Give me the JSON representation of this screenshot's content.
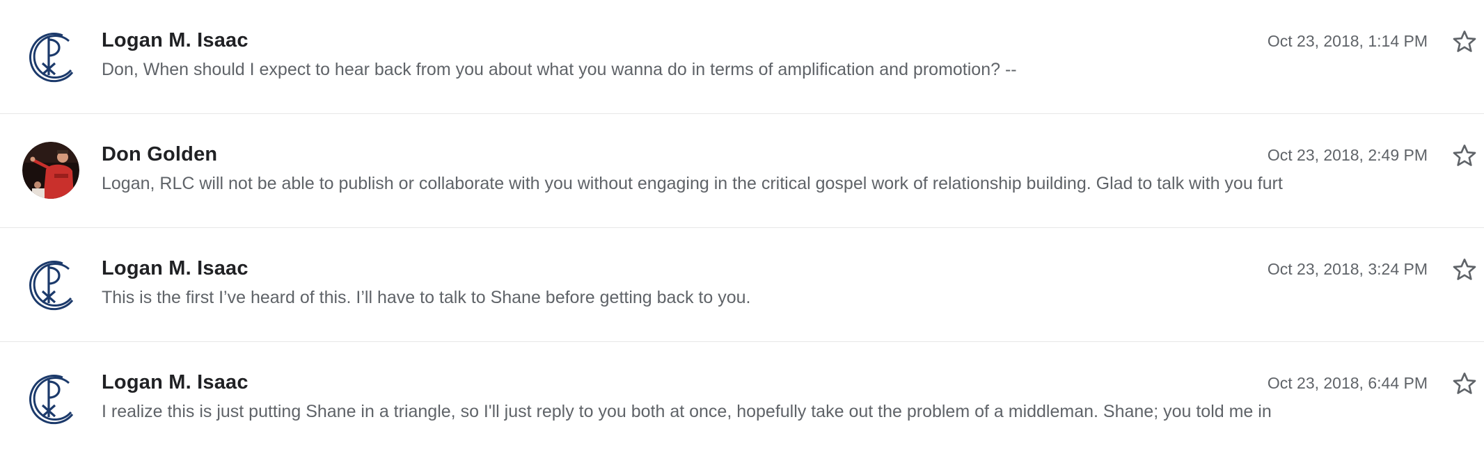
{
  "messages": [
    {
      "sender": "Logan M. Isaac",
      "avatar": "chi-rho-logo-icon",
      "date": "Oct 23, 2018, 1:14 PM",
      "snippet": "Don, When should I expect to hear back from you about what you wanna do in terms of amplification and promotion? --",
      "starred": false
    },
    {
      "sender": "Don Golden",
      "avatar": "profile-photo",
      "date": "Oct 23, 2018, 2:49 PM",
      "snippet": "Logan, RLC will not be able to publish or collaborate with you without engaging in the critical gospel work of relationship building. Glad to talk with you furt",
      "starred": false
    },
    {
      "sender": "Logan M. Isaac",
      "avatar": "chi-rho-logo-icon",
      "date": "Oct 23, 2018, 3:24 PM",
      "snippet": "This is the first I’ve heard of this. I’ll have to talk to Shane before getting back to you.",
      "starred": false
    },
    {
      "sender": "Logan M. Isaac",
      "avatar": "chi-rho-logo-icon",
      "date": "Oct 23, 2018, 6:44 PM",
      "snippet": "I realize this is just putting Shane in a triangle, so I'll just reply to you both at once, hopefully take out the problem of a middleman. Shane; you told me in",
      "starred": false
    }
  ],
  "colors": {
    "logo_navy": "#1c3a6b",
    "sender_text": "#202124",
    "secondary_text": "#5f6368",
    "divider": "#e6e6e6",
    "star_outline": "#5f6368",
    "photo_red": "#c9302c"
  }
}
